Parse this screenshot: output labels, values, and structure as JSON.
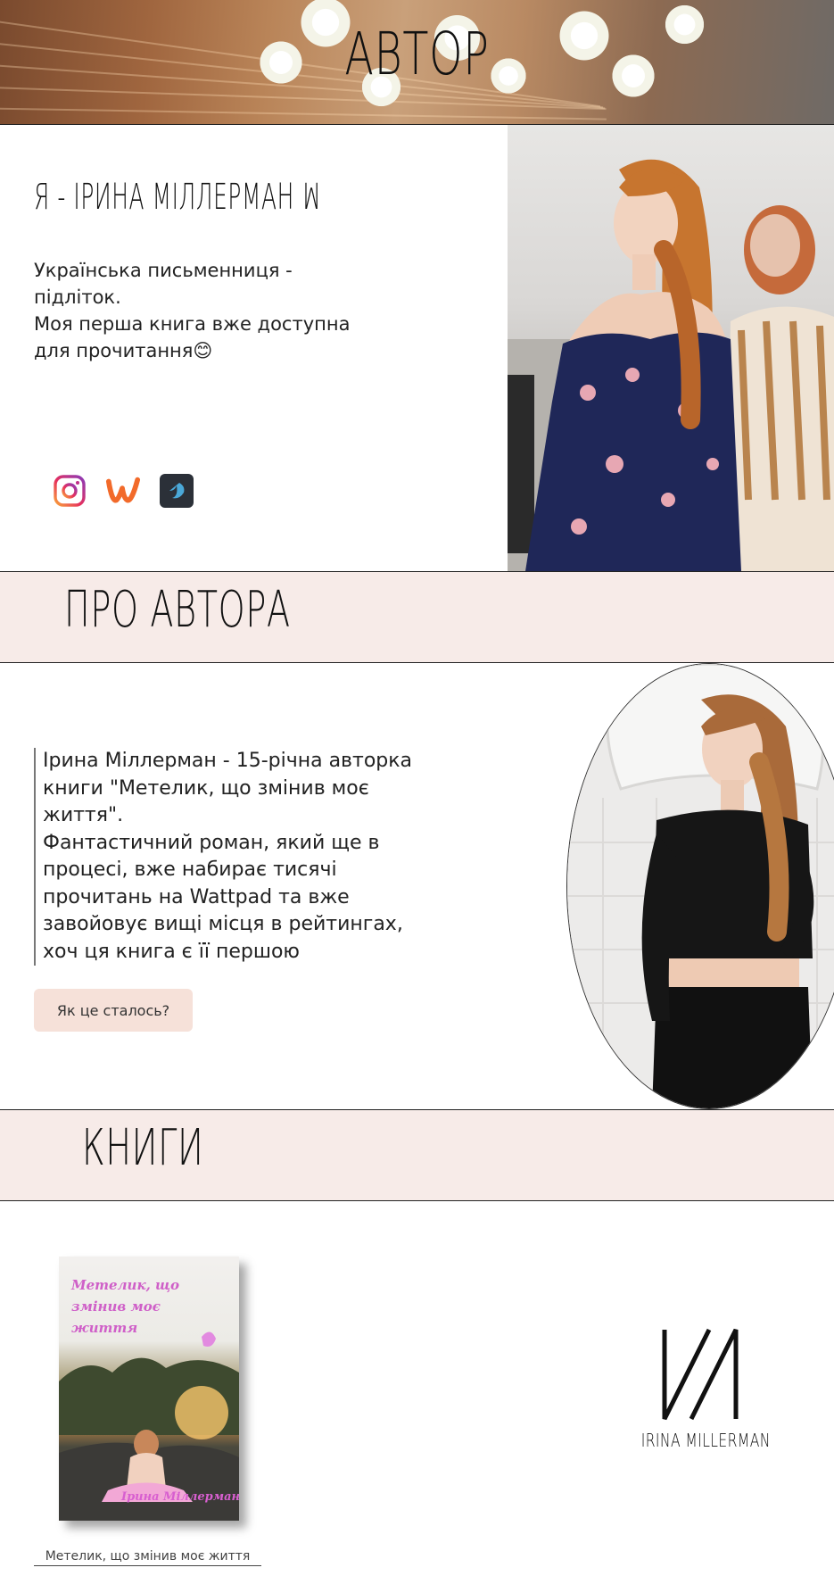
{
  "hero": {
    "title": "АВТОР"
  },
  "intro": {
    "heading": "Я -  ІРИНА МІЛЛЕРМАН  ꟽ",
    "lines": [
      "Українська письменниця -",
      "підліток.",
      "Моя перша книга вже доступна",
      "для прочитання😊"
    ],
    "socials": [
      "instagram-icon",
      "wattpad-icon",
      "telegraph-icon"
    ]
  },
  "about": {
    "title": "ПРО АВТОРА",
    "lines": [
      "Ірина Міллерман - 15-річна авторка",
      "книги \"Метелик, що змінив моє",
      "життя\".",
      "Фантастичний роман, який ще в",
      "процесі, вже набирає тисячі",
      "прочитань на Wattpad та вже",
      "завойовує вищі місця в рейтингах,",
      "хоч ця книга є її першою"
    ],
    "button_label": "Як це сталось?"
  },
  "books": {
    "title": "КНИГИ",
    "cover_title_lines": [
      "Метелик, що",
      "змінив моє",
      "життя"
    ],
    "cover_author": "Ірина Міллерман",
    "caption": "Метелик, що змінив моє життя",
    "logo_text": "IRINA MILLERMAN"
  },
  "colors": {
    "band_bg": "#f7ebe8",
    "button_bg": "#f6e1d9",
    "cover_title": "#cf5fc8"
  }
}
